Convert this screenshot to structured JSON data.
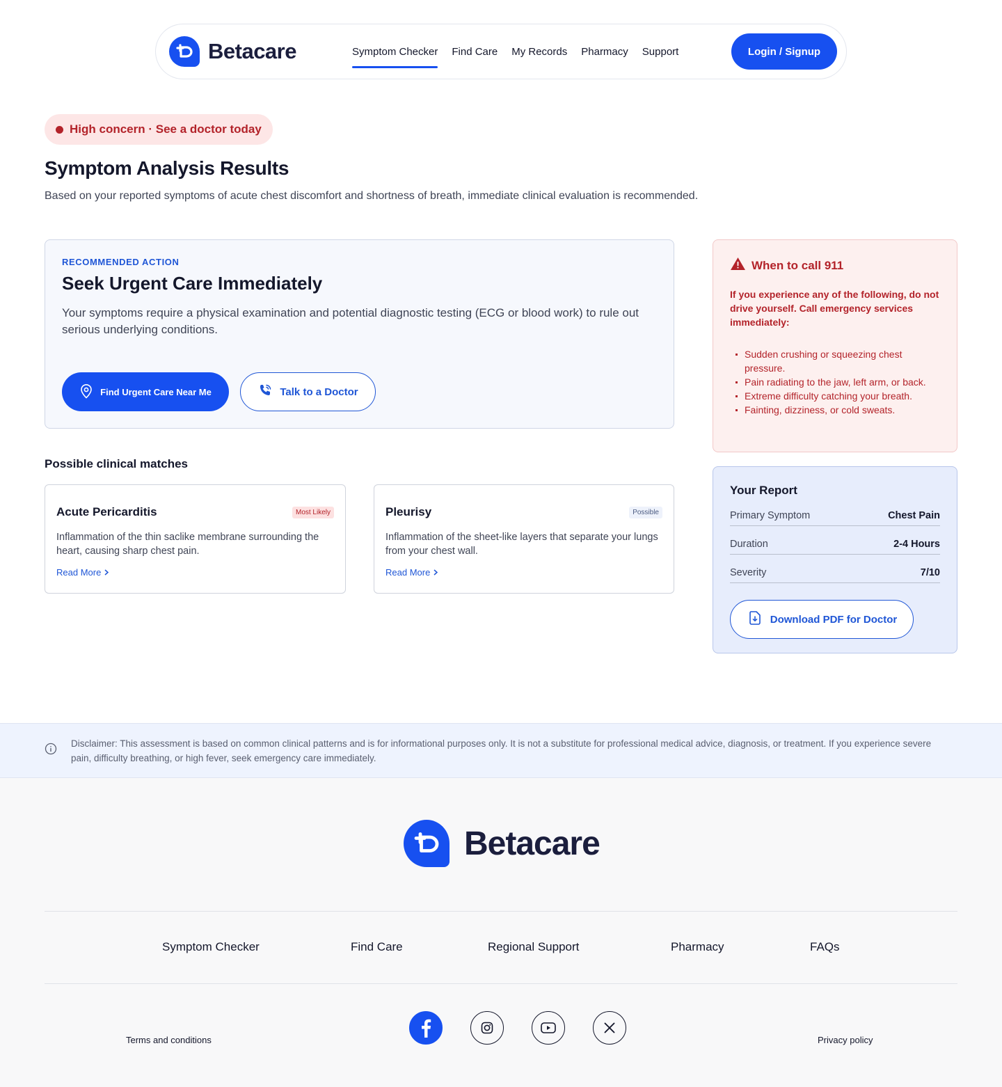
{
  "brand": {
    "name": "Betacare",
    "accent": "#1750f0",
    "danger": "#b3232a"
  },
  "nav": {
    "links": [
      "Symptom Checker",
      "Find Care",
      "My Records",
      "Pharmacy",
      "Support"
    ],
    "active": "Symptom Checker",
    "login_label": "Login / Signup"
  },
  "concern_badge": "High concern · See a doctor today",
  "page": {
    "title": "Symptom Analysis Results",
    "subtitle": "Based on your reported symptoms of acute chest discomfort and shortness of breath, immediate clinical evaluation is recommended."
  },
  "action": {
    "eyebrow": "RECOMMENDED ACTION",
    "title": "Seek Urgent Care Immediately",
    "description": "Your symptoms require a physical examination and potential diagnostic testing (ECG or blood work) to rule out serious underlying conditions.",
    "primary_label": "Find Urgent Care Near Me",
    "primary_icon": "location-pin-icon",
    "secondary_label": "Talk to a Doctor",
    "secondary_icon": "phone-icon"
  },
  "matches": {
    "title": "Possible clinical matches",
    "items": [
      {
        "name": "Acute Pericarditis",
        "tag": "Most Likely",
        "description": "Inflammation of the thin saclike membrane surrounding the heart, causing sharp chest pain.",
        "link": "Read More"
      },
      {
        "name": "Pleurisy",
        "tag": "Possible",
        "description": "Inflammation of the sheet-like layers that separate your lungs from your chest wall.",
        "link": "Read More"
      }
    ]
  },
  "emergency": {
    "title": "When to call 911",
    "icon": "warning-icon",
    "intro": "If you experience any of the following, do not drive yourself. Call emergency services immediately:",
    "items": [
      "Sudden crushing or squeezing chest pressure.",
      "Pain radiating to the jaw, left arm, or back.",
      "Extreme difficulty catching your breath.",
      "Fainting, dizziness, or cold sweats."
    ]
  },
  "report": {
    "title": "Your Report",
    "rows": [
      {
        "label": "Primary Symptom",
        "value": "Chest Pain"
      },
      {
        "label": "Duration",
        "value": "2-4 Hours"
      },
      {
        "label": "Severity",
        "value": "7/10"
      }
    ],
    "download_label": "Download PDF for Doctor",
    "download_icon": "file-download-icon"
  },
  "disclaimer": "Disclaimer: This assessment is based on common clinical patterns and is for informational purposes only. It is not a substitute for professional medical advice, diagnosis, or treatment. If you experience severe pain, difficulty breathing, or high fever, seek emergency care immediately.",
  "footer": {
    "links": [
      "Symptom Checker",
      "Find Care",
      "Regional Support",
      "Pharmacy",
      "FAQs"
    ],
    "social": [
      "facebook-icon",
      "instagram-icon",
      "youtube-icon",
      "x-icon"
    ],
    "terms": "Terms and conditions",
    "privacy": "Privacy policy"
  }
}
